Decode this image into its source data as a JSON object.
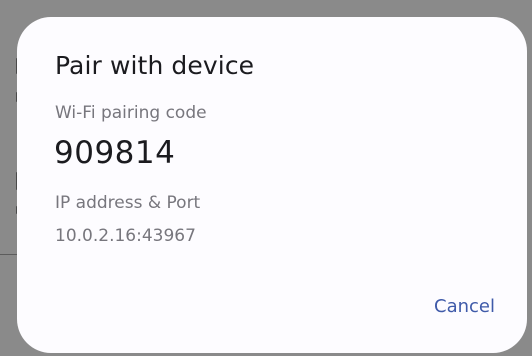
{
  "dialog": {
    "title": "Pair with device",
    "code_label": "Wi-Fi pairing code",
    "code_value": "909814",
    "ip_label": "IP address & Port",
    "ip_value": "10.0.2.16:43967",
    "cancel_label": "Cancel"
  },
  "colors": {
    "accent": "#3f5aa9",
    "scrim": "#767676",
    "dialog_background": "#fdfcff"
  }
}
